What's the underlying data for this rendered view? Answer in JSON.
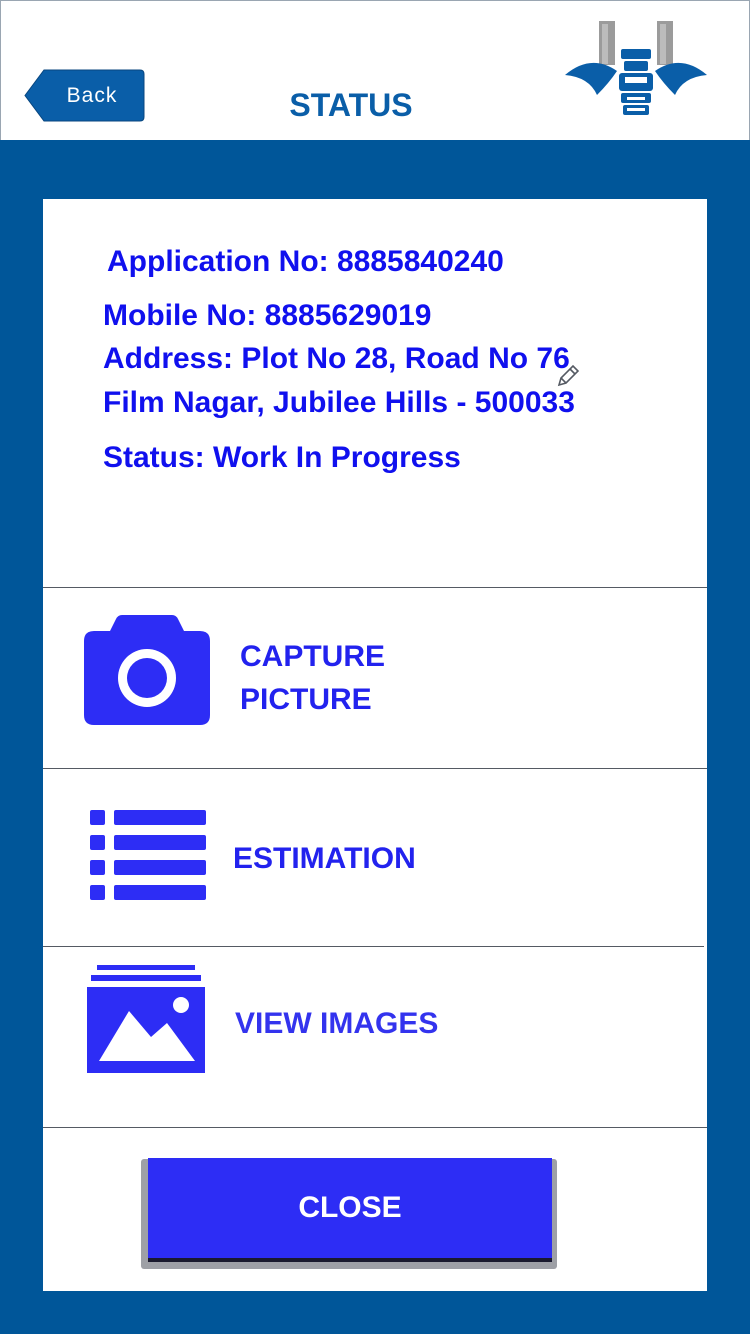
{
  "header": {
    "back_label": "Back",
    "title": "STATUS",
    "logo_icon": "water-utility-logo-icon"
  },
  "info": {
    "application": "Application No: 8885840240",
    "mobile": "Mobile No: 8885629019",
    "address_line1": "Address: Plot No 28, Road No 76",
    "address_line2": "Film Nagar, Jubilee Hills - 500033",
    "status": "Status: Work In Progress"
  },
  "actions": {
    "capture_line1": "CAPTURE",
    "capture_line2": "PICTURE",
    "estimation": "ESTIMATION",
    "view_images": "VIEW IMAGES"
  },
  "close_label": "CLOSE",
  "colors": {
    "frame_blue": "#005699",
    "text_blue": "#1010ee",
    "icon_blue": "#2d2df5",
    "header_title": "#0a5ea8"
  }
}
